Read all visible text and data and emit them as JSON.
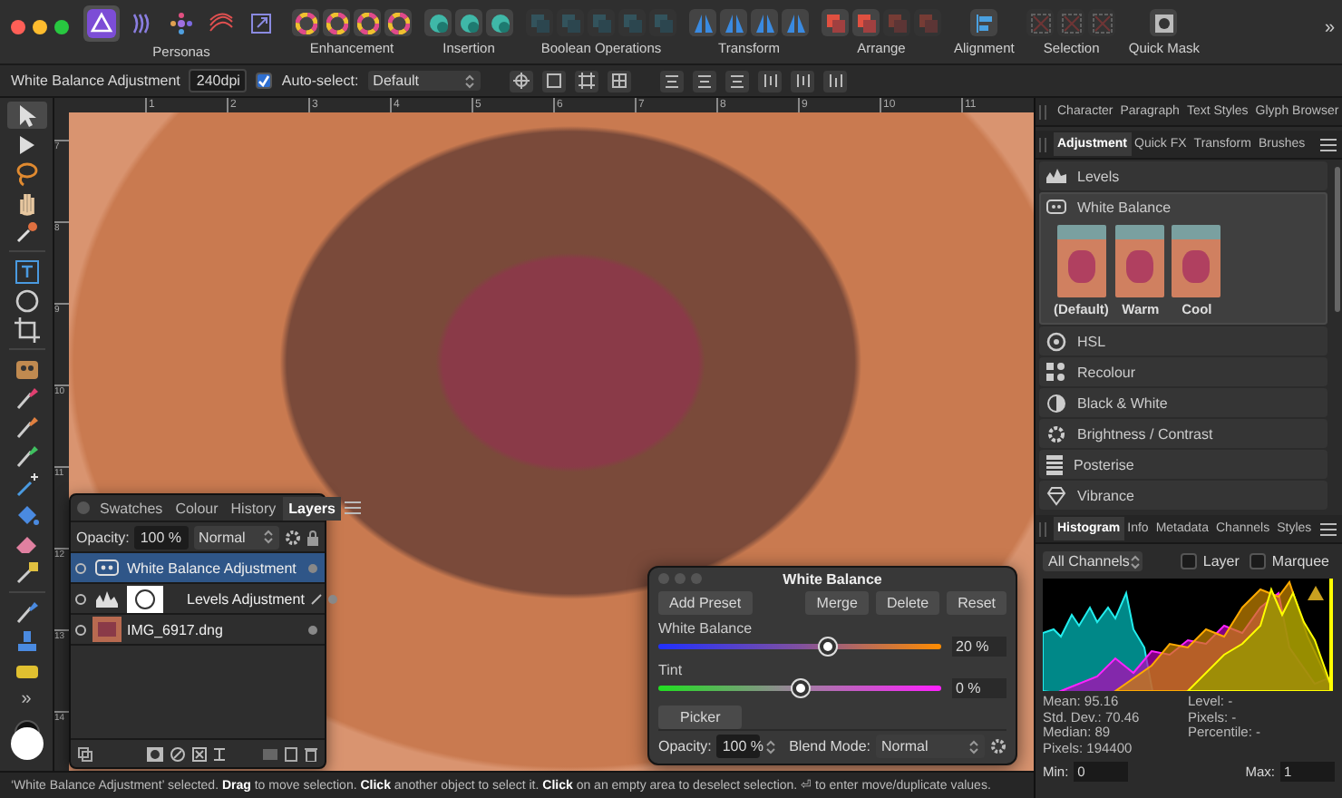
{
  "personas": {
    "label": "Personas",
    "items": [
      {
        "selected": true
      },
      {
        "selected": false
      },
      {
        "selected": false
      },
      {
        "selected": false
      },
      {
        "selected": false
      }
    ]
  },
  "toolbar_groups": [
    {
      "label": "Enhancement",
      "tools": [
        {
          "disabled": false
        },
        {
          "disabled": false
        },
        {
          "disabled": false
        },
        {
          "disabled": false
        }
      ]
    },
    {
      "label": "Insertion",
      "tools": [
        {
          "disabled": false
        },
        {
          "disabled": false
        },
        {
          "disabled": false
        }
      ]
    },
    {
      "label": "Boolean Operations",
      "tools": [
        {
          "disabled": true
        },
        {
          "disabled": true
        },
        {
          "disabled": true
        },
        {
          "disabled": true
        },
        {
          "disabled": true
        }
      ]
    },
    {
      "label": "Transform",
      "tools": [
        {
          "disabled": false
        },
        {
          "disabled": false
        },
        {
          "disabled": false
        },
        {
          "disabled": false
        }
      ]
    },
    {
      "label": "Arrange",
      "tools": [
        {
          "disabled": false
        },
        {
          "disabled": false
        },
        {
          "disabled": true
        },
        {
          "disabled": true
        }
      ]
    },
    {
      "label": "Alignment",
      "tools": [
        {
          "disabled": false
        }
      ]
    },
    {
      "label": "Selection",
      "tools": [
        {
          "disabled": true
        },
        {
          "disabled": true
        },
        {
          "disabled": true
        }
      ]
    },
    {
      "label": "Quick Mask",
      "tools": [
        {
          "disabled": false
        }
      ]
    }
  ],
  "toolbar_overflow": "»",
  "context_bar": {
    "layer_name": "White Balance Adjustment",
    "resolution": "240dpi",
    "auto_select": {
      "label": "Auto-select:",
      "checked": true
    },
    "auto_select_mode": "Default"
  },
  "tools": [
    {
      "kind": "pointer",
      "selected": true
    },
    {
      "kind": "node",
      "selected": false
    },
    {
      "kind": "lasso",
      "selected": false
    },
    {
      "kind": "hand",
      "selected": false
    },
    {
      "kind": "picker",
      "selected": false
    },
    {
      "kind": "text",
      "selected": false
    },
    {
      "kind": "ellipse",
      "selected": false
    },
    {
      "kind": "crop",
      "selected": false
    },
    {
      "kind": "mesh",
      "selected": false
    },
    {
      "kind": "brush",
      "selected": false
    },
    {
      "kind": "dodge",
      "selected": false
    },
    {
      "kind": "selection-brush",
      "selected": false
    },
    {
      "kind": "wand",
      "selected": false
    },
    {
      "kind": "fill",
      "selected": false
    },
    {
      "kind": "eraser",
      "selected": false
    },
    {
      "kind": "clone",
      "selected": false
    },
    {
      "kind": "smudge",
      "selected": false
    },
    {
      "kind": "stamp",
      "selected": false
    },
    {
      "kind": "sponge",
      "selected": false
    }
  ],
  "tools_overflow": "»",
  "rulers": {
    "horizontal": [
      "1",
      "2",
      "3",
      "4",
      "5",
      "6",
      "7",
      "8",
      "9",
      "10",
      "11"
    ],
    "vertical": [
      "7",
      "8",
      "9",
      "10",
      "11",
      "12",
      "13",
      "14"
    ]
  },
  "layers_panel": {
    "tabs": [
      {
        "label": "Swatches",
        "selected": false
      },
      {
        "label": "Colour",
        "selected": false
      },
      {
        "label": "History",
        "selected": false
      },
      {
        "label": "Layers",
        "selected": true
      }
    ],
    "opacity_label": "Opacity:",
    "opacity": "100 %",
    "blend_mode": "Normal",
    "layers": [
      {
        "name": "White Balance Adjustment",
        "kind": "white-balance",
        "selected": true,
        "mask": false
      },
      {
        "name": "Levels Adjustment",
        "kind": "levels",
        "selected": false,
        "mask": true
      },
      {
        "name": "IMG_6917.dng",
        "kind": "image",
        "selected": false,
        "mask": false
      }
    ]
  },
  "white_balance_dialog": {
    "title": "White Balance",
    "buttons": [
      "Add Preset",
      "Merge",
      "Delete",
      "Reset"
    ],
    "sliders": [
      {
        "kind": "temperature",
        "label": "White Balance",
        "level": 0.6,
        "reading": "20 %"
      },
      {
        "kind": "tint",
        "label": "Tint",
        "level": 0.5,
        "reading": "0 %"
      }
    ],
    "picker": "Picker",
    "opacity_label": "Opacity:",
    "opacity": "100 %",
    "blend_mode_label": "Blend Mode:",
    "blend_mode": "Normal"
  },
  "status_bar": {
    "text": "‘White Balance Adjustment’ selected. **Drag** to move selection. **Click** another object to select it. **Click** on an empty area to deselect selection. ⏎ to enter move/duplicate values."
  },
  "right_panel": {
    "text_tabs": [
      {
        "label": "Character",
        "selected": false
      },
      {
        "label": "Paragraph",
        "selected": false
      },
      {
        "label": "Text Styles",
        "selected": false
      },
      {
        "label": "Glyph Browser",
        "selected": false
      }
    ],
    "adjustment_tabs": [
      {
        "label": "Adjustment",
        "selected": true
      },
      {
        "label": "Quick FX",
        "selected": false
      },
      {
        "label": "Transform",
        "selected": false
      },
      {
        "label": "Brushes",
        "selected": false
      }
    ],
    "adjustments": [
      {
        "label": "Levels",
        "expanded": false
      },
      {
        "label": "White Balance",
        "expanded": true,
        "presets": [
          "(Default)",
          "Warm",
          "Cool"
        ]
      },
      {
        "label": "HSL",
        "expanded": false
      },
      {
        "label": "Recolour",
        "expanded": false
      },
      {
        "label": "Black & White",
        "expanded": false
      },
      {
        "label": "Brightness / Contrast",
        "expanded": false
      },
      {
        "label": "Posterise",
        "expanded": false
      },
      {
        "label": "Vibrance",
        "expanded": false
      }
    ],
    "histogram_tabs": [
      {
        "label": "Histogram",
        "selected": true
      },
      {
        "label": "Info",
        "selected": false
      },
      {
        "label": "Metadata",
        "selected": false
      },
      {
        "label": "Channels",
        "selected": false
      },
      {
        "label": "Styles",
        "selected": false
      }
    ],
    "channel": "All Channels",
    "checkboxes": [
      {
        "label": "Layer",
        "checked": false
      },
      {
        "label": "Marquee",
        "checked": false
      }
    ],
    "stats": [
      "Mean: 95.16",
      "Std. Dev.: 70.46",
      "Median: 89",
      "Pixels: 194400"
    ],
    "cursor_stats": [
      "Level: -",
      "Pixels: -",
      "Percentile: -"
    ],
    "min_label": "Min:",
    "min": "0",
    "max_label": "Max:",
    "max": "1"
  }
}
